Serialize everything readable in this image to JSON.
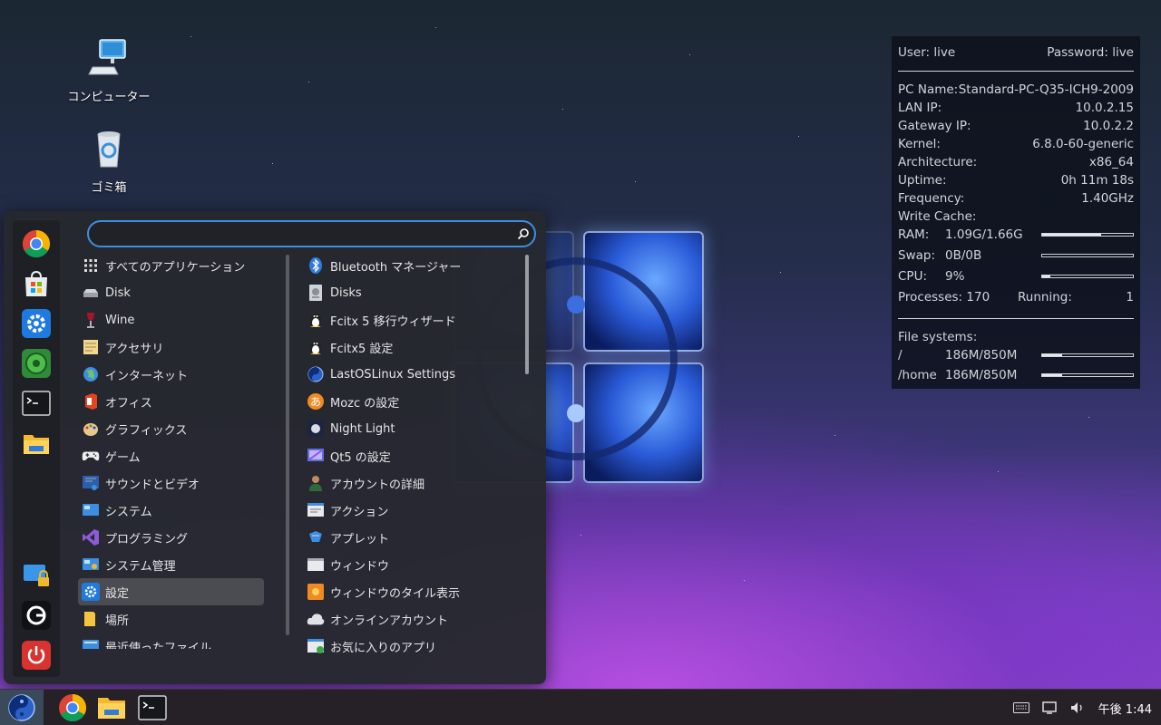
{
  "desktop": {
    "computer_label": "コンピューター",
    "trash_label": "ゴミ箱"
  },
  "conky": {
    "user": "User: live",
    "password": "Password: live",
    "pc_name_label": "PC Name:",
    "pc_name": "Standard-PC-Q35-ICH9-2009",
    "lan_ip_label": "LAN IP:",
    "lan_ip": "10.0.2.15",
    "gateway_label": "Gateway IP:",
    "gateway": "10.0.2.2",
    "kernel_label": "Kernel:",
    "kernel": "6.8.0-60-generic",
    "arch_label": "Architecture:",
    "arch": "x86_64",
    "uptime_label": "Uptime:",
    "uptime": "0h 11m 18s",
    "freq_label": "Frequency:",
    "freq": "1.40GHz",
    "write_cache_label": "Write Cache:",
    "ram_label": "RAM:",
    "ram_value": "1.09G/1.66G",
    "ram_fill": 0.65,
    "swap_label": "Swap:",
    "swap_value": "0B/0B",
    "swap_fill": 0,
    "cpu_label": "CPU:",
    "cpu_value": "9%",
    "cpu_fill": 0.09,
    "processes_label": "Processes:",
    "processes": "170",
    "running_label": "Running:",
    "running": "1",
    "fs_label": "File systems:",
    "fs_root_label": "/",
    "fs_root_value": "186M/850M",
    "fs_root_fill": 0.22,
    "fs_home_label": "/home",
    "fs_home_value": "186M/850M",
    "fs_home_fill": 0.22
  },
  "menu": {
    "search_value": "",
    "categories": [
      {
        "label": "すべてのアプリケーション",
        "icon": "grid-icon"
      },
      {
        "label": "Disk",
        "icon": "disk-icon"
      },
      {
        "label": "Wine",
        "icon": "wine-icon"
      },
      {
        "label": "アクセサリ",
        "icon": "accessories-icon"
      },
      {
        "label": "インターネット",
        "icon": "globe-icon"
      },
      {
        "label": "オフィス",
        "icon": "office-icon"
      },
      {
        "label": "グラフィックス",
        "icon": "graphics-icon"
      },
      {
        "label": "ゲーム",
        "icon": "gamepad-icon"
      },
      {
        "label": "サウンドとビデオ",
        "icon": "multimedia-icon"
      },
      {
        "label": "システム",
        "icon": "system-icon"
      },
      {
        "label": "プログラミング",
        "icon": "programming-icon"
      },
      {
        "label": "システム管理",
        "icon": "admin-icon"
      },
      {
        "label": "設定",
        "icon": "gear-icon"
      },
      {
        "label": "場所",
        "icon": "folder-icon"
      },
      {
        "label": "最近使ったファイル",
        "icon": "recent-icon"
      }
    ],
    "apps": [
      {
        "label": "Bluetooth マネージャー",
        "icon": "bluetooth-icon"
      },
      {
        "label": "Disks",
        "icon": "disks-icon"
      },
      {
        "label": "Fcitx 5 移行ウィザード",
        "icon": "tux-icon"
      },
      {
        "label": "Fcitx5 設定",
        "icon": "tux-icon"
      },
      {
        "label": "LastOSLinux Settings",
        "icon": "lastos-icon"
      },
      {
        "label": "Mozc の設定",
        "icon": "mozc-icon"
      },
      {
        "label": "Night Light",
        "icon": "night-light-icon"
      },
      {
        "label": "Qt5 の設定",
        "icon": "qt-icon"
      },
      {
        "label": "アカウントの詳細",
        "icon": "account-icon"
      },
      {
        "label": "アクション",
        "icon": "action-icon"
      },
      {
        "label": "アプレット",
        "icon": "applet-icon"
      },
      {
        "label": "ウィンドウ",
        "icon": "window-icon"
      },
      {
        "label": "ウィンドウのタイル表示",
        "icon": "tile-icon"
      },
      {
        "label": "オンラインアカウント",
        "icon": "cloud-icon"
      },
      {
        "label": "お気に入りのアプリ",
        "icon": "favorite-apps-icon"
      }
    ]
  },
  "tray": {
    "clock": "午後 1:44"
  }
}
